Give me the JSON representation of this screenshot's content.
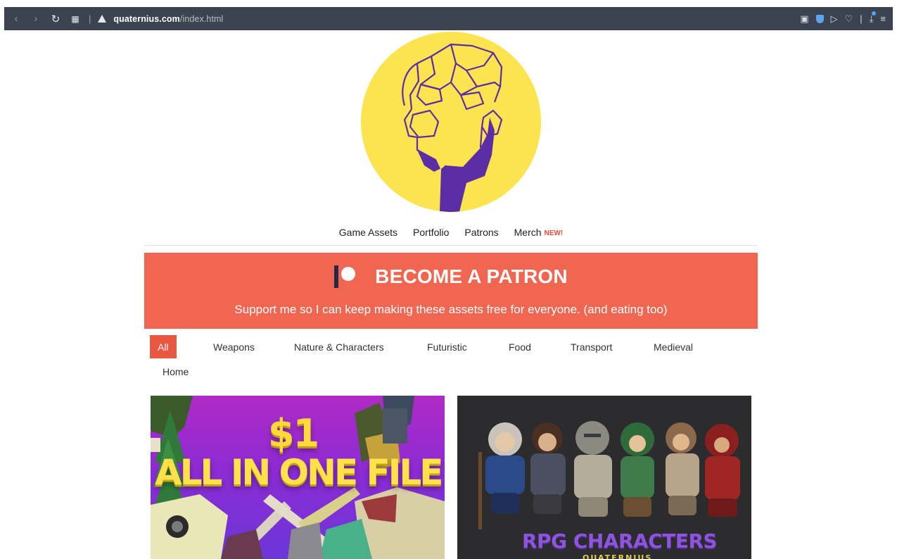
{
  "browser": {
    "url_host": "quaternius.com",
    "url_path": "/index.html",
    "sep": "|",
    "sep2": "|"
  },
  "nav": {
    "items": [
      "Game Assets",
      "Portfolio",
      "Patrons",
      "Merch"
    ],
    "new_badge": "NEW!"
  },
  "banner": {
    "title": "BECOME A PATRON",
    "subtitle": "Support me so I can keep making these assets free for everyone. (and eating too)"
  },
  "filters": {
    "items": [
      "All",
      "Weapons",
      "Nature & Characters",
      "Futuristic",
      "Food",
      "Transport",
      "Medieval",
      "Home"
    ],
    "active": "All"
  },
  "cards": [
    {
      "price": "$1",
      "headline": "ALL IN ONE FILE"
    },
    {
      "headline": "RPG CHARACTERS",
      "subline": "QUATERNIUS"
    }
  ],
  "colors": {
    "banner": "#f06651",
    "active_filter": "#e8573f",
    "logo_yellow": "#fbe44f",
    "logo_purple": "#5b2ea6"
  }
}
